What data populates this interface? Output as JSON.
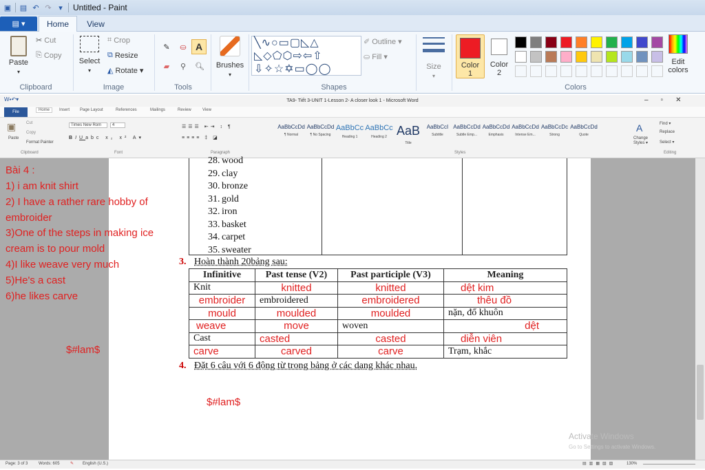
{
  "titlebar": {
    "title": "Untitled - Paint"
  },
  "paint_tabs": {
    "file": "▤ ▾",
    "home": "Home",
    "view": "View"
  },
  "ribbon": {
    "paste": "Paste",
    "cut": "Cut",
    "copy": "Copy",
    "select": "Select",
    "crop": "Crop",
    "resize": "Resize",
    "rotate": "Rotate ▾",
    "brushes": "Brushes",
    "outline": "Outline ▾",
    "fill": "Fill ▾",
    "size": "Size",
    "color1": "Color\n1",
    "color1_a": "Color",
    "color1_b": "1",
    "color2_a": "Color",
    "color2_b": "2",
    "edit_colors_a": "Edit",
    "edit_colors_b": "colors",
    "groups": {
      "clipboard": "Clipboard",
      "image": "Image",
      "tools": "Tools",
      "shapes": "Shapes",
      "colors": "Colors"
    },
    "palette": [
      "#000000",
      "#7f7f7f",
      "#880015",
      "#ed1c24",
      "#ff7f27",
      "#fff200",
      "#22b14c",
      "#00a2e8",
      "#3f48cc",
      "#a349a4",
      "#ffffff",
      "#c3c3c3",
      "#b97a57",
      "#ffaec9",
      "#ffc90e",
      "#efe4b0",
      "#b5e61d",
      "#99d9ea",
      "#7092be",
      "#c8bfe7"
    ],
    "color1_value": "#ed1c24",
    "color2_value": "#ffffff"
  },
  "word": {
    "title": "TA9- Tiết 3-UNIT 1-Lesson 2- A closer look 1 - Microsoft Word",
    "tabs": [
      "File",
      "Home",
      "Insert",
      "Page Layout",
      "References",
      "Mailings",
      "Review",
      "View"
    ],
    "font_name": "Times New Rom",
    "font_size": "4",
    "clip_cut": "Cut",
    "clip_copy": "Copy",
    "clip_fp": "Format Painter",
    "clip_paste": "Paste",
    "styles": [
      {
        "sample": "AaBbCcDd",
        "name": "¶ Normal"
      },
      {
        "sample": "AaBbCcDd",
        "name": "¶ No Spacing"
      },
      {
        "sample": "AaBbCc",
        "name": "Heading 1"
      },
      {
        "sample": "AaBbCc",
        "name": "Heading 2"
      },
      {
        "sample": "AaB",
        "name": "Title"
      },
      {
        "sample": "AaBbCcI",
        "name": "Subtitle"
      },
      {
        "sample": "AaBbCcDd",
        "name": "Subtle Emp..."
      },
      {
        "sample": "AaBbCcDd",
        "name": "Emphasis"
      },
      {
        "sample": "AaBbCcDd",
        "name": "Intense Em..."
      },
      {
        "sample": "AaBbCcDc",
        "name": "Strong"
      },
      {
        "sample": "AaBbCcDd",
        "name": "Quote"
      }
    ],
    "change_styles": "Change Styles ▾",
    "find": "Find ▾",
    "replace": "Replace",
    "select": "Select ▾",
    "groups": {
      "clipboard": "Clipboard",
      "font": "Font",
      "paragraph": "Paragraph",
      "styles": "Styles",
      "editing": "Editing"
    }
  },
  "document": {
    "list": [
      {
        "num": "28.",
        "txt": "wood"
      },
      {
        "num": "29.",
        "txt": "clay"
      },
      {
        "num": "30.",
        "txt": "bronze"
      },
      {
        "num": "31.",
        "txt": "gold"
      },
      {
        "num": "32.",
        "txt": "iron"
      },
      {
        "num": "33.",
        "txt": "basket"
      },
      {
        "num": "34.",
        "txt": "carpet"
      },
      {
        "num": "35.",
        "txt": "sweater"
      }
    ],
    "q3_num": "3.",
    "q3_text": "Hoàn thành 20bảng sau:",
    "table_headers": [
      "Infinitive",
      "Past tense (V2)",
      "Past participle (V3)",
      "Meaning"
    ],
    "rows": [
      [
        "Knit",
        "knitted",
        "knitted",
        "dệt kim"
      ],
      [
        "embroider",
        "embroidered",
        "embroidered",
        "thêu đồ"
      ],
      [
        "mould",
        "moulded",
        "moulded",
        "nặn, đổ khuôn"
      ],
      [
        "weave",
        "move",
        "woven",
        "dệt"
      ],
      [
        "Cast",
        "casted",
        "casted",
        "diễn viên"
      ],
      [
        "carve",
        "carved",
        "carve",
        "Trạm, khắc"
      ]
    ],
    "q4_num": "4.",
    "q4_text": "Đặt 6 câu với 6 động từ trong bảng ở các dạng khác nhau."
  },
  "annotations": {
    "title": "Bài 4 :",
    "lines": [
      "1) i am knit shirt",
      "2) I have a rather rare hobby of",
      "embroider",
      "3)One of the steps in making ice",
      "cream is to pour mold",
      "4)I like weave very much",
      "5)He's a cast",
      " 6)he likes carve"
    ],
    "sig1": "$#lam$",
    "sig2": "$#lam$"
  },
  "watermark": {
    "line1": "Activate Windows",
    "line2": "Go to Settings to activate Windows."
  },
  "status": {
    "page": "Page: 3 of 3",
    "words": "Words: 605",
    "lang": "English (U.S.)",
    "zoom": "130%"
  }
}
